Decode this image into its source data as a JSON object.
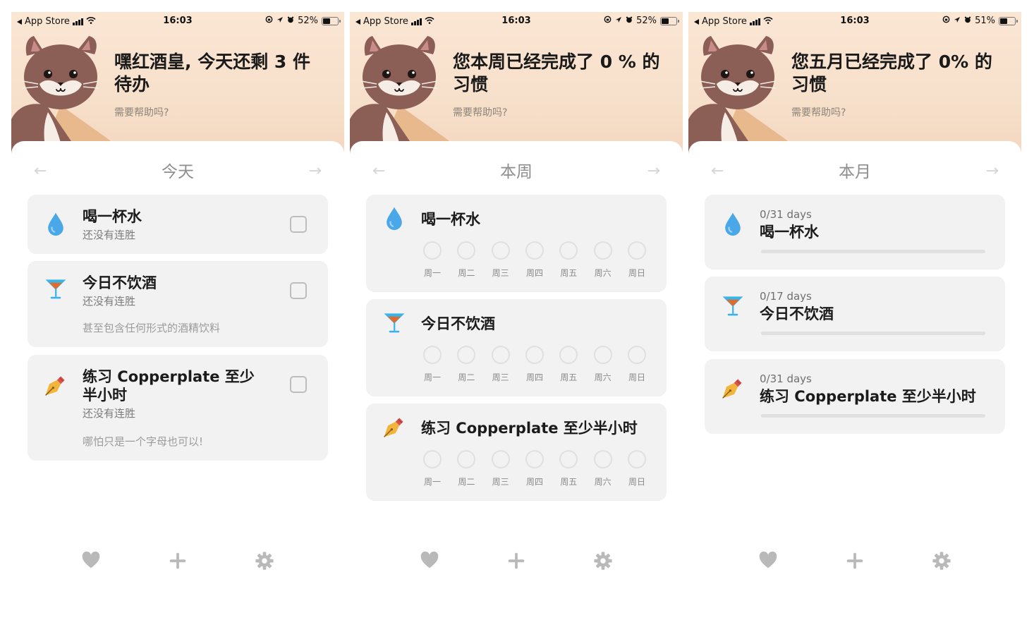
{
  "status_bars": [
    {
      "back_app": "App Store",
      "time": "16:03",
      "battery": "52%",
      "battery_level": 0.52
    },
    {
      "back_app": "App Store",
      "time": "16:03",
      "battery": "52%",
      "battery_level": 0.52
    },
    {
      "back_app": "App Store",
      "time": "16:03",
      "battery": "51%",
      "battery_level": 0.51
    }
  ],
  "screens": [
    {
      "headline": "嘿红酒皇, 今天还剩 3 件待办",
      "help": "需要帮助吗?",
      "period": "今天",
      "habits": [
        {
          "icon": "water-drop-icon",
          "title": "喝一杯水",
          "streak": "还没有连胜",
          "note": ""
        },
        {
          "icon": "cocktail-glass-icon",
          "title": "今日不饮酒",
          "streak": "还没有连胜",
          "note": "甚至包含任何形式的酒精饮料"
        },
        {
          "icon": "fountain-pen-icon",
          "title": "练习 Copperplate 至少半小时",
          "streak": "还没有连胜",
          "note": "哪怕只是一个字母也可以!"
        }
      ]
    },
    {
      "headline": "您本周已经完成了 0 % 的习惯",
      "help": "需要帮助吗?",
      "period": "本周",
      "weekdays": [
        "周一",
        "周二",
        "周三",
        "周四",
        "周五",
        "周六",
        "周日"
      ],
      "habits": [
        {
          "icon": "water-drop-icon",
          "title": "喝一杯水"
        },
        {
          "icon": "cocktail-glass-icon",
          "title": "今日不饮酒"
        },
        {
          "icon": "fountain-pen-icon",
          "title": "练习 Copperplate 至少半小时"
        }
      ]
    },
    {
      "headline": "您五月已经完成了 0% 的习惯",
      "help": "需要帮助吗?",
      "period": "本月",
      "habits": [
        {
          "icon": "water-drop-icon",
          "title": "喝一杯水",
          "days": "0/31 days",
          "progress": 0
        },
        {
          "icon": "cocktail-glass-icon",
          "title": "今日不饮酒",
          "days": "0/17 days",
          "progress": 0
        },
        {
          "icon": "fountain-pen-icon",
          "title": "练习 Copperplate 至少半小时",
          "days": "0/31 days",
          "progress": 0
        }
      ]
    }
  ],
  "nav": {
    "prev_arrow": "←",
    "next_arrow": "→"
  },
  "tabbar": [
    "heart-icon",
    "plus-icon",
    "gear-icon"
  ],
  "colors": {
    "hero_bg": "#f8e3cf",
    "card_bg": "#f2f2f2",
    "water": "#4aa8e8",
    "cat_fur": "#8b5e56"
  }
}
